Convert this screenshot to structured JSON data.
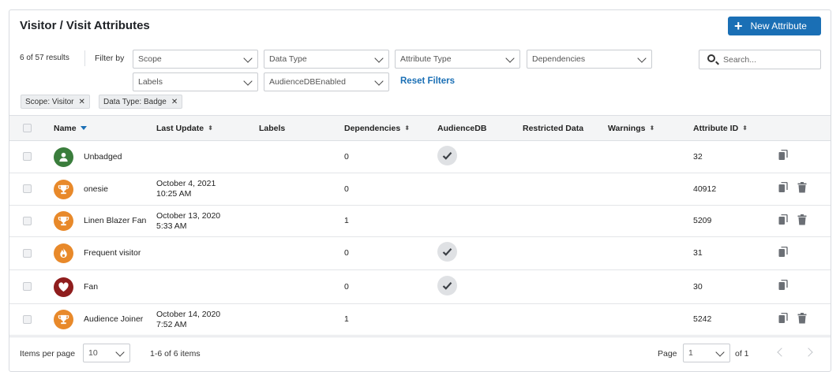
{
  "header": {
    "title": "Visitor / Visit Attributes",
    "new_button": "New Attribute"
  },
  "filters": {
    "results": "6 of 57 results",
    "filter_by": "Filter by",
    "scope": "Scope",
    "data_type": "Data Type",
    "attribute_type": "Attribute Type",
    "dependencies": "Dependencies",
    "labels": "Labels",
    "audience_db": "AudienceDBEnabled",
    "reset": "Reset Filters",
    "search_placeholder": "Search..."
  },
  "chips": [
    {
      "label": "Scope: Visitor"
    },
    {
      "label": "Data Type: Badge"
    }
  ],
  "table": {
    "columns": [
      "Name",
      "Last Update",
      "Labels",
      "Dependencies",
      "AudienceDB",
      "Restricted Data",
      "Warnings",
      "Attribute ID"
    ],
    "rows": [
      {
        "name": "Unbadged",
        "update_date": "",
        "update_time": "",
        "dependencies": "0",
        "audience_db": true,
        "attribute_id": "32",
        "deletable": false,
        "badge_color": "#3a7d3c",
        "badge_icon": "person-icon"
      },
      {
        "name": "onesie",
        "update_date": "October 4, 2021",
        "update_time": "10:25 AM",
        "dependencies": "0",
        "audience_db": false,
        "attribute_id": "40912",
        "deletable": true,
        "badge_color": "#e8892a",
        "badge_icon": "trophy-icon"
      },
      {
        "name": "Linen Blazer Fan",
        "update_date": "October 13, 2020",
        "update_time": "5:33 AM",
        "dependencies": "1",
        "audience_db": false,
        "attribute_id": "5209",
        "deletable": true,
        "badge_color": "#e8892a",
        "badge_icon": "trophy-icon"
      },
      {
        "name": "Frequent visitor",
        "update_date": "",
        "update_time": "",
        "dependencies": "0",
        "audience_db": true,
        "attribute_id": "31",
        "deletable": false,
        "badge_color": "#e8892a",
        "badge_icon": "flame-icon"
      },
      {
        "name": "Fan",
        "update_date": "",
        "update_time": "",
        "dependencies": "0",
        "audience_db": true,
        "attribute_id": "30",
        "deletable": false,
        "badge_color": "#8f1d1d",
        "badge_icon": "heart-icon"
      },
      {
        "name": "Audience Joiner",
        "update_date": "October 14, 2020",
        "update_time": "7:52 AM",
        "dependencies": "1",
        "audience_db": false,
        "attribute_id": "5242",
        "deletable": true,
        "badge_color": "#e8892a",
        "badge_icon": "trophy-icon"
      }
    ]
  },
  "footer": {
    "items_per_page_label": "Items per page",
    "items_per_page": "10",
    "range": "1-6 of 6 items",
    "page_label": "Page",
    "page": "1",
    "of": "of 1"
  },
  "colors": {
    "accent": "#1a6fb5"
  }
}
